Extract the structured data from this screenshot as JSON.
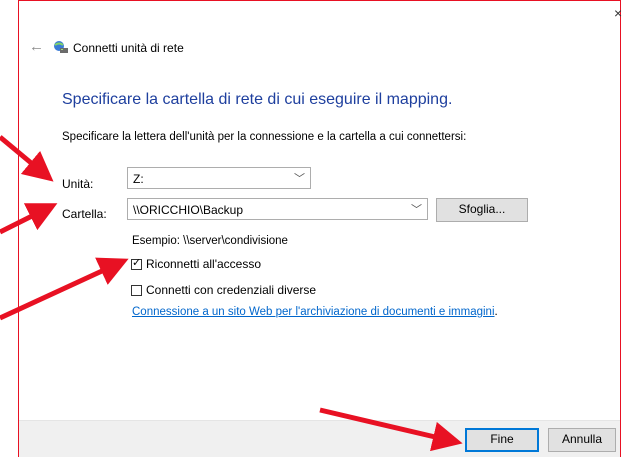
{
  "window": {
    "title": "Connetti unità di rete",
    "close_glyph": "×",
    "back_glyph": "←"
  },
  "dialog": {
    "heading": "Specificare la cartella di rete di cui eseguire il mapping.",
    "instruction": "Specificare la lettera dell'unità per la connessione e la cartella a cui connettersi:",
    "drive_label": "Unità:",
    "drive_value": "Z:",
    "folder_label": "Cartella:",
    "folder_value": "\\\\ORICCHIO\\Backup",
    "browse_button": "Sfoglia...",
    "example_text": "Esempio: \\\\server\\condivisione",
    "reconnect_label": "Riconnetti all'accesso",
    "reconnect_checked": true,
    "credentials_label": "Connetti con credenziali diverse",
    "credentials_checked": false,
    "link_text": "Connessione a un sito Web per l'archiviazione di documenti e immagini",
    "link_suffix": "."
  },
  "footer": {
    "finish_button": "Fine",
    "cancel_button": "Annulla"
  },
  "colors": {
    "heading": "#1e3f9e",
    "link": "#0066cc",
    "annotation_arrow": "#e81123",
    "frame_border": "#e81123",
    "primary_button_border": "#0078d7"
  },
  "icons": {
    "back": "back-arrow-icon",
    "title": "network-drive-icon",
    "chevron": "chevron-down-icon"
  }
}
